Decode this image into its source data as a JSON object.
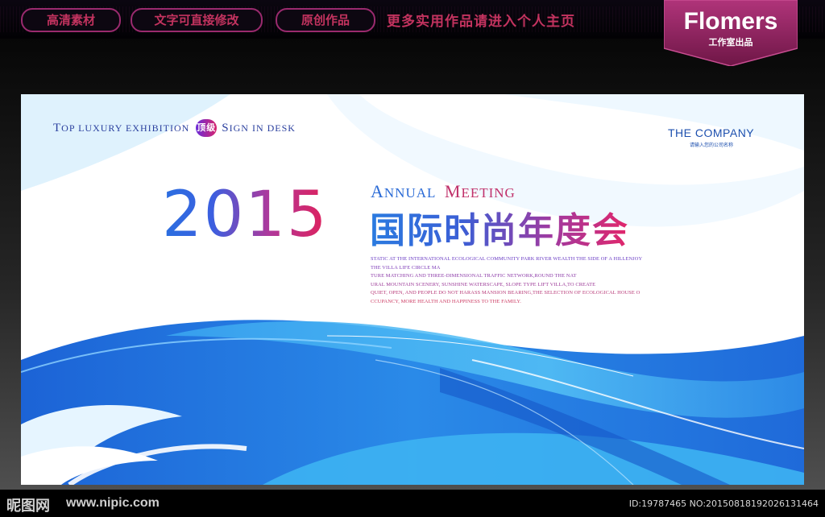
{
  "topbar": {
    "pills": [
      "高清素材",
      "文字可直接修改",
      "原创作品"
    ],
    "promo": "更多实用作品请进入个人主页"
  },
  "brand": {
    "name": "Flomers",
    "sub": "工作室出品"
  },
  "banner": {
    "tagline_parts": [
      "T",
      "OP ",
      "LUXURY EXHIBITION",
      "顶级",
      "S",
      "IGN IN DESK"
    ],
    "company": "THE COMPANY",
    "company_sub": "请输入您的公司名称",
    "year": "2015",
    "annual_parts": [
      "A",
      "NNUAL",
      "M",
      "EETING"
    ],
    "cn_title": "国际时尚年度会",
    "desc_lines": [
      "STATIC AT THE INTERNATIONAL ECOLOGICAL COMMUNITY PARK RIVER WEALTH THE SIDE OF A HILLENJOY",
      "THE VILLA LIFE CIRCLE MA",
      "TURE MATCHING AND THREE-DIMENSIONAL TRAFFIC NETWORK,ROUND THE NAT",
      "URAL MOUNTAIN SCENERY, SUNSHINE WATERSCAPE, SLOPE TYPE LIFT VILLA,TO CREATE",
      "QUIET, OPEN, AND PEOPLE DO NOT HARASS MANSION BEARING,THE SELECTION OF ECOLOGICAL HOUSE O",
      "CCUPANCY, MORE HEALTH AND HAPPINESS TO THE FAMILY."
    ]
  },
  "footer": {
    "logo": "昵图网",
    "url": "www.nipic.com",
    "id_text": "ID:19787465 NO:20150818192026131464"
  },
  "colors": {
    "pill_border": "#9a2a6e",
    "pill_text": "#c3335f",
    "brand_bg": "#8a1e5a",
    "wave_blue": "#1f6fd8",
    "wave_light": "#bfe6ff"
  }
}
